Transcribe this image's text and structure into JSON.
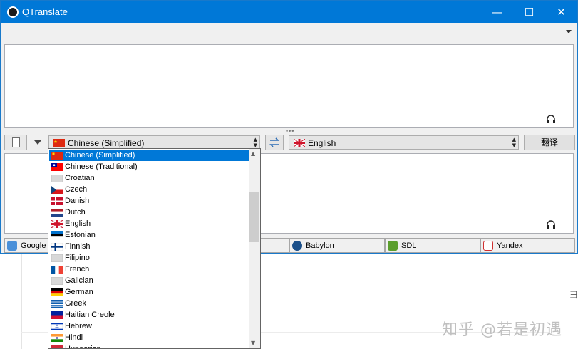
{
  "window": {
    "title": "QTranslate",
    "controls": {
      "minimize": "—",
      "maximize": "☐",
      "close": "✕"
    }
  },
  "source_language": {
    "selected": "Chinese (Simplified)"
  },
  "target_language": {
    "selected": "English"
  },
  "translate_button": {
    "label": "翻译"
  },
  "services": [
    {
      "label": "Google T",
      "color": "#4a90d9"
    },
    {
      "label": "Babylon",
      "color": "#1a4f8a"
    },
    {
      "label": "SDL",
      "color": "#5b9e2d"
    },
    {
      "label": "Yandex",
      "color": "#d03030"
    }
  ],
  "language_list": [
    {
      "label": "Chinese (Simplified)",
      "flag": "cn"
    },
    {
      "label": "Chinese (Traditional)",
      "flag": "tw"
    },
    {
      "label": "Croatian",
      "flag": "plain"
    },
    {
      "label": "Czech",
      "flag": "cz"
    },
    {
      "label": "Danish",
      "flag": "dk"
    },
    {
      "label": "Dutch",
      "flag": "nl"
    },
    {
      "label": "English",
      "flag": "gb"
    },
    {
      "label": "Estonian",
      "flag": "ee"
    },
    {
      "label": "Finnish",
      "flag": "fi"
    },
    {
      "label": "Filipino",
      "flag": "plain"
    },
    {
      "label": "French",
      "flag": "fr"
    },
    {
      "label": "Galician",
      "flag": "plain"
    },
    {
      "label": "German",
      "flag": "de"
    },
    {
      "label": "Greek",
      "flag": "gr"
    },
    {
      "label": "Haitian Creole",
      "flag": "ht"
    },
    {
      "label": "Hebrew",
      "flag": "il"
    },
    {
      "label": "Hindi",
      "flag": "in"
    },
    {
      "label": "Hungarian",
      "flag": "hu"
    }
  ],
  "watermark": "知乎 @若是初遇",
  "background_glyph": "彐",
  "colors": {
    "titlebar": "#0078d7",
    "selection": "#0078d7"
  }
}
